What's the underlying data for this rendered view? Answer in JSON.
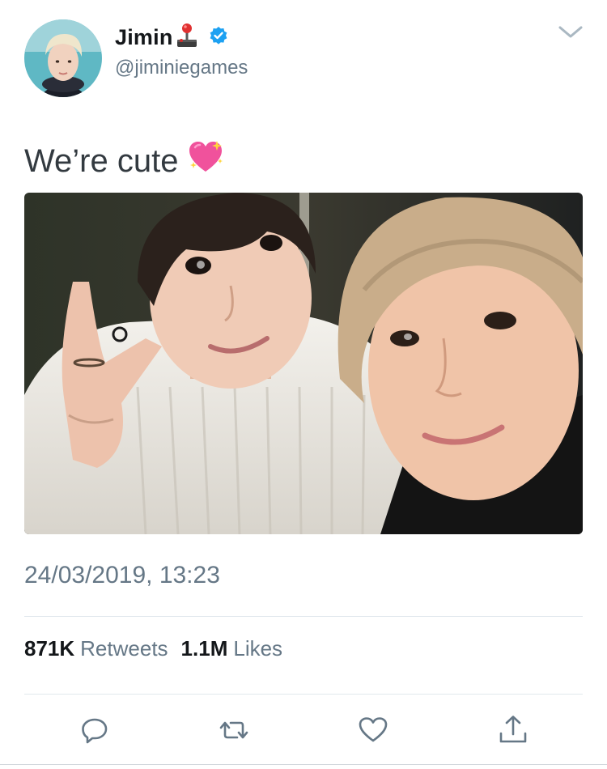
{
  "tweet": {
    "author": {
      "display_name": "Jimin",
      "handle": "@jiminiegames",
      "verified": true,
      "name_emoji": "joystick-icon",
      "avatar": "avatar"
    },
    "menu_icon": "chevron-down-icon",
    "text": "We’re cute",
    "text_emoji": "sparkling-heart-icon",
    "photo": "selfie-photo",
    "timestamp": "24/03/2019, 13:23",
    "stats": {
      "retweets_count": "871K",
      "retweets_label": "Retweets",
      "likes_count": "1.1M",
      "likes_label": "Likes"
    },
    "actions": [
      "reply-icon",
      "retweet-icon",
      "like-icon",
      "share-icon"
    ]
  },
  "colors": {
    "text_primary": "#14171a",
    "text_secondary": "#657786",
    "verified_blue": "#1da1f2",
    "divider": "#e1e8ed",
    "icon_gray": "#657786"
  }
}
